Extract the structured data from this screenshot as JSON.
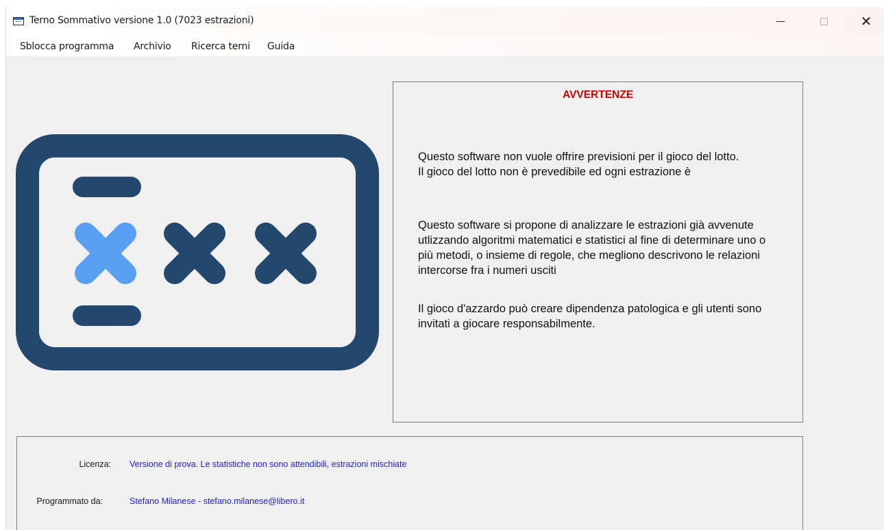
{
  "window": {
    "title": "Terno Sommativo versione 1.0 (7023 estrazioni)",
    "controls": {
      "minimize_icon": "minimize-icon",
      "maximize_icon": "maximize-icon",
      "close_icon": "close-icon"
    }
  },
  "menu": {
    "items": [
      {
        "label": "Sblocca programma"
      },
      {
        "label": "Archivio"
      },
      {
        "label": "Ricerca terni"
      },
      {
        "label": "Guida"
      }
    ]
  },
  "logo": {
    "icon": "terno-crosses-logo",
    "frame_color": "#24476e",
    "accent_color": "#5aa0f2"
  },
  "warnings": {
    "title": "AVVERTENZE",
    "title_color": "#d00000",
    "paragraph1": "Questo software non vuole offrire previsioni per il gioco del lotto.\nIl gioco del lotto non è prevedibile ed ogni estrazione è",
    "paragraph2": "Questo software si propone di analizzare le estrazioni già avvenute utlizzando algoritmi matematici e statistici al fine di determinare  uno o più metodi, o insieme di regole, che megliono descrivono le relazioni intercorse fra i numeri usciti",
    "paragraph3": "Il gioco d'azzardo può creare dipendenza patologica e gli utenti sono invitati a giocare responsabilmente."
  },
  "info": {
    "license_label": "Licenza:",
    "license_value": "Versione di prova. Le statistiche non sono attendibili, estrazioni mischiate",
    "author_label": "Programmato da:",
    "author_value": "Stefano Milanese - stefano.milanese@libero.it",
    "value_color": "#2222cc"
  }
}
